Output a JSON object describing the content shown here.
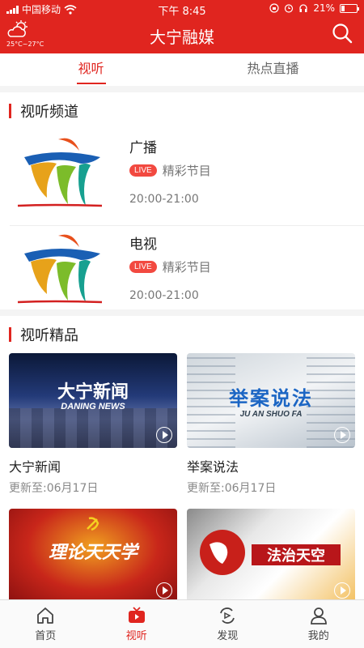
{
  "status_bar": {
    "carrier": "中国移动",
    "time": "下午 8:45",
    "battery": "21%",
    "battery_level": 0.21
  },
  "header": {
    "title": "大宁融媒",
    "weather_temp": "25°C~27°C",
    "weather_icon": "cloud-sun-icon",
    "search_icon": "search-icon"
  },
  "tabs": [
    {
      "label": "视听",
      "active": true
    },
    {
      "label": "热点直播",
      "active": false
    }
  ],
  "channels_section": {
    "title": "视听频道",
    "items": [
      {
        "name": "广播",
        "badge": "LIVE",
        "desc": "精彩节目",
        "time": "20:00-21:00"
      },
      {
        "name": "电视",
        "badge": "LIVE",
        "desc": "精彩节目",
        "time": "20:00-21:00"
      }
    ]
  },
  "premium_section": {
    "title": "视听精品",
    "items": [
      {
        "title": "大宁新闻",
        "update": "更新至:06月17日",
        "thumb_text": "大宁新闻",
        "thumb_sub": "DANING NEWS"
      },
      {
        "title": "举案说法",
        "update": "更新至:06月17日",
        "thumb_text": "举案说法",
        "thumb_sub": "JU AN SHUO FA"
      },
      {
        "title": "",
        "update": "",
        "thumb_text": "理论天天学",
        "thumb_sub": ""
      },
      {
        "title": "",
        "update": "",
        "thumb_text": "法治天空",
        "thumb_sub": ""
      }
    ]
  },
  "bottom_nav": [
    {
      "label": "首页",
      "icon": "home-icon",
      "active": false
    },
    {
      "label": "视听",
      "icon": "tv-icon",
      "active": true
    },
    {
      "label": "发现",
      "icon": "discover-icon",
      "active": false
    },
    {
      "label": "我的",
      "icon": "user-icon",
      "active": false
    }
  ],
  "colors": {
    "brand_red": "#e0251f",
    "live_badge": "#f24940"
  }
}
